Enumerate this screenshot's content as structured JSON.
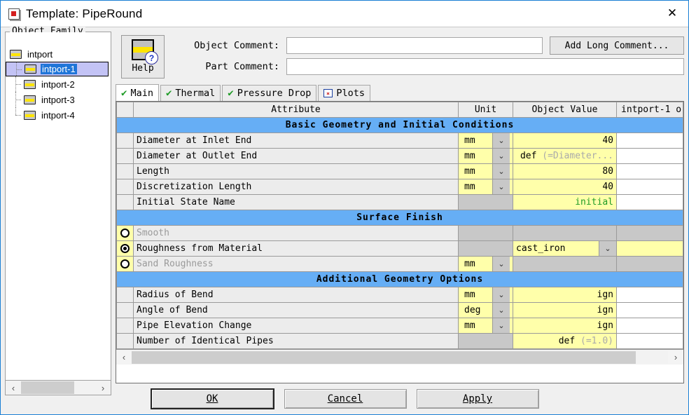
{
  "window": {
    "title": "Template: PipeRound",
    "app_icon": "template-icon",
    "close_label": "✕"
  },
  "tree": {
    "legend": "Object Family",
    "items": [
      {
        "label": "intport",
        "level": 0,
        "selected": false
      },
      {
        "label": "intport-1",
        "level": 1,
        "selected": true
      },
      {
        "label": "intport-2",
        "level": 1,
        "selected": false
      },
      {
        "label": "intport-3",
        "level": 1,
        "selected": false
      },
      {
        "label": "intport-4",
        "level": 1,
        "selected": false
      }
    ],
    "scroll_left": "‹",
    "scroll_right": "›"
  },
  "help": {
    "label": "Help",
    "question_mark": "?"
  },
  "comments": {
    "object_label": "Object Comment:",
    "object_value": "",
    "object_placeholder": "",
    "part_label": "Part Comment:",
    "part_value": "",
    "part_placeholder": "",
    "add_long_comment": "Add Long Comment..."
  },
  "tabs": [
    {
      "label": "Main",
      "icon": "green-check-icon",
      "active": true
    },
    {
      "label": "Thermal",
      "icon": "green-check-icon",
      "active": false
    },
    {
      "label": "Pressure Drop",
      "icon": "green-check-icon",
      "active": false
    },
    {
      "label": "Plots",
      "icon": "plot-chart-icon",
      "active": false
    }
  ],
  "table": {
    "headers": {
      "radio": "",
      "attribute": "Attribute",
      "unit": "Unit",
      "object_value": "Object Value",
      "instance": "intport-1 o"
    },
    "sections": [
      {
        "title": "Basic Geometry and Initial Conditions",
        "rows": [
          {
            "attribute": "Diameter at Inlet End",
            "unit": "mm",
            "unit_kind": "dropdown",
            "value": "40",
            "value_kind": "number",
            "value_dim": "",
            "instance": "",
            "instance_kind": "white"
          },
          {
            "attribute": "Diameter at Outlet End",
            "unit": "mm",
            "unit_kind": "dropdown",
            "value": "def",
            "value_kind": "default",
            "value_dim": "(=Diameter...",
            "instance": "",
            "instance_kind": "white"
          },
          {
            "attribute": "Length",
            "unit": "mm",
            "unit_kind": "dropdown",
            "value": "80",
            "value_kind": "number",
            "value_dim": "",
            "instance": "",
            "instance_kind": "white"
          },
          {
            "attribute": "Discretization Length",
            "unit": "mm",
            "unit_kind": "dropdown",
            "value": "40",
            "value_kind": "number",
            "value_dim": "",
            "instance": "",
            "instance_kind": "white"
          },
          {
            "attribute": "Initial State Name",
            "unit": "",
            "unit_kind": "grey",
            "value": "initial",
            "value_kind": "green",
            "value_dim": "",
            "instance": "",
            "instance_kind": "white"
          }
        ]
      },
      {
        "title": "Surface Finish",
        "rows": [
          {
            "attribute": "Smooth",
            "radio": "off",
            "disabled": true,
            "unit": "",
            "unit_kind": "grey",
            "value": "",
            "value_kind": "grey",
            "value_dim": "",
            "instance": "",
            "instance_kind": "grey"
          },
          {
            "attribute": "Roughness from Material",
            "radio": "on",
            "disabled": false,
            "unit": "",
            "unit_kind": "grey",
            "value": "cast_iron",
            "value_kind": "combo",
            "value_dim": "",
            "instance": "",
            "instance_kind": "yellow"
          },
          {
            "attribute": "Sand Roughness",
            "radio": "off",
            "disabled": true,
            "unit": "mm",
            "unit_kind": "dropdown",
            "value": "",
            "value_kind": "grey",
            "value_dim": "",
            "instance": "",
            "instance_kind": "grey"
          }
        ]
      },
      {
        "title": "Additional Geometry Options",
        "rows": [
          {
            "attribute": "Radius of Bend",
            "unit": "mm",
            "unit_kind": "dropdown",
            "value": "ign",
            "value_kind": "number",
            "value_dim": "",
            "instance": "",
            "instance_kind": "white"
          },
          {
            "attribute": "Angle of Bend",
            "unit": "deg",
            "unit_kind": "dropdown",
            "value": "ign",
            "value_kind": "number",
            "value_dim": "",
            "instance": "",
            "instance_kind": "white"
          },
          {
            "attribute": "Pipe Elevation Change",
            "unit": "mm",
            "unit_kind": "dropdown",
            "value": "ign",
            "value_kind": "number",
            "value_dim": "",
            "instance": "",
            "instance_kind": "white"
          },
          {
            "attribute": "Number of Identical Pipes",
            "unit": "",
            "unit_kind": "grey",
            "value": "def",
            "value_kind": "default",
            "value_dim": "(=1.0)",
            "instance": "",
            "instance_kind": "white"
          }
        ]
      }
    ],
    "scroll_left": "‹",
    "scroll_right": "›",
    "dropdown_glyph": "⌄"
  },
  "footer": {
    "ok": "OK",
    "ok_mnemonic": "O",
    "cancel": "Cancel",
    "cancel_mnemonic": "C",
    "apply": "Apply",
    "apply_mnemonic": "A"
  },
  "colors": {
    "section_blue": "#66aef5",
    "field_yellow": "#ffffaa",
    "selection_blue": "#1f75d8",
    "selection_row": "#c3c3f5",
    "green_text": "#1f9b26",
    "window_border": "#1a7fd4"
  }
}
